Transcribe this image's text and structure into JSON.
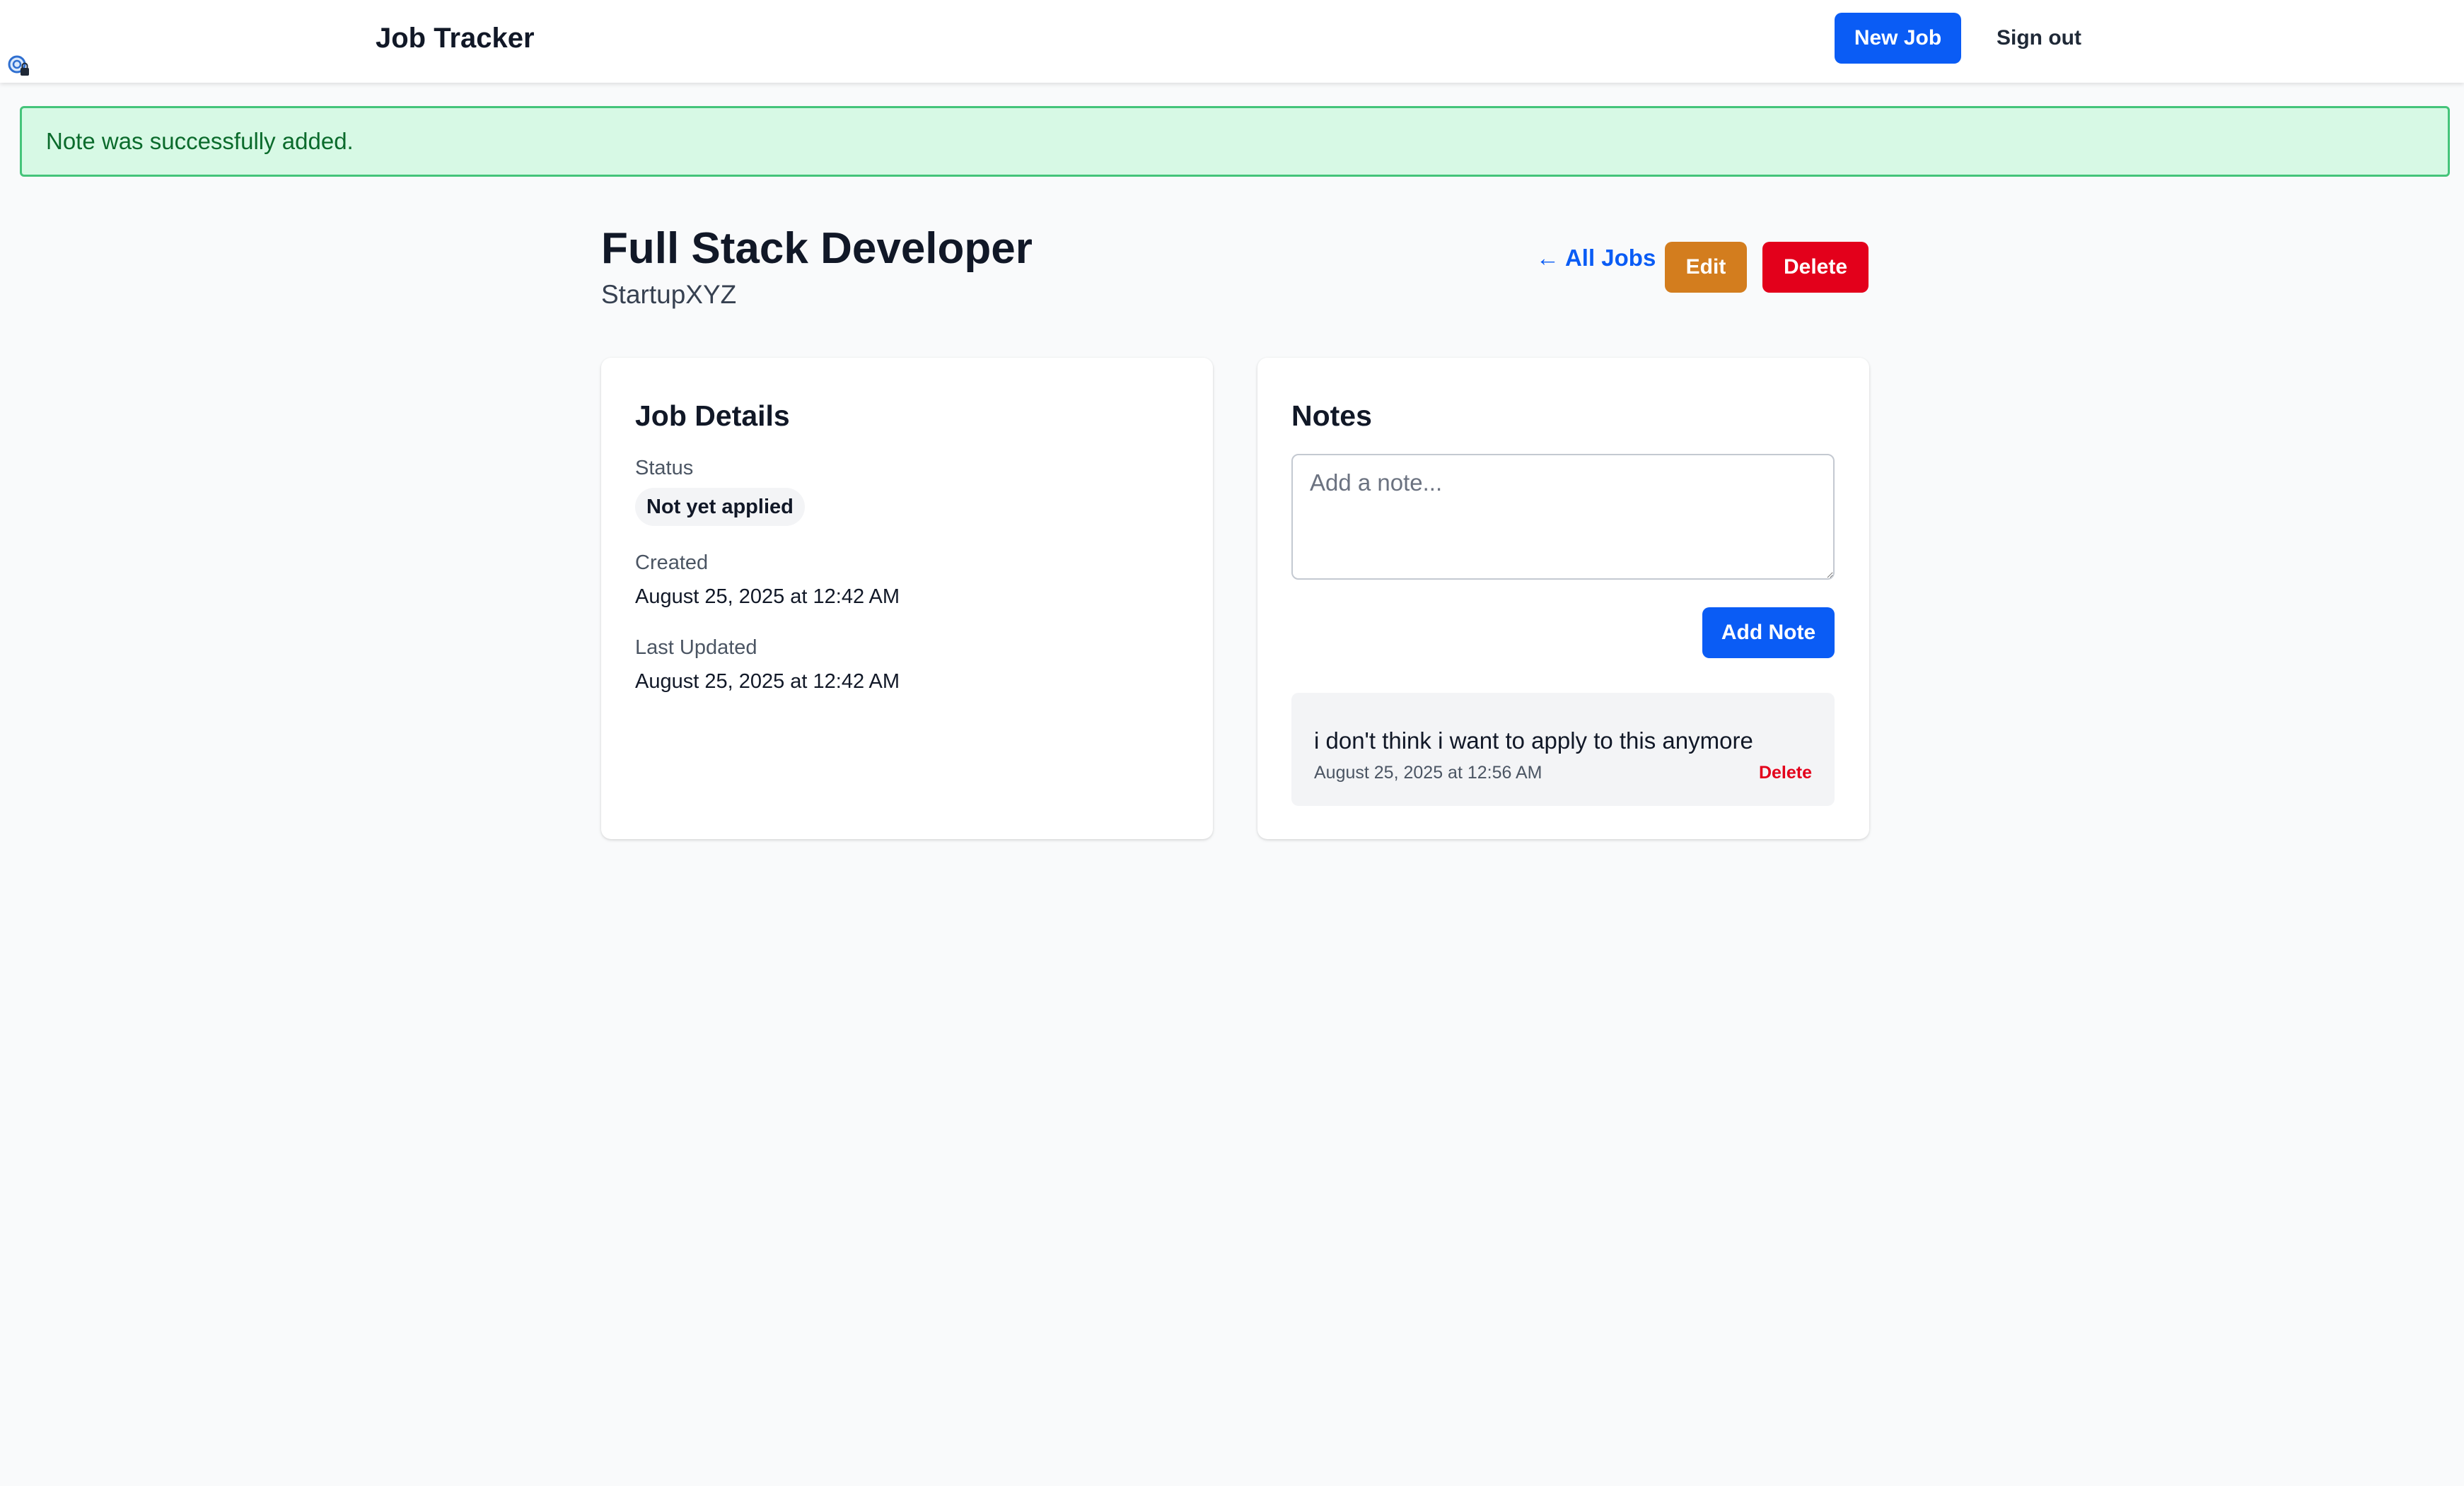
{
  "nav": {
    "brand": "Job Tracker",
    "new_job_label": "New Job",
    "sign_out_label": "Sign out",
    "extension_icon": "lock-badge-icon"
  },
  "flash": {
    "message": "Note was successfully added."
  },
  "job": {
    "title": "Full Stack Developer",
    "company": "StartupXYZ"
  },
  "actions": {
    "all_jobs_label": "← All Jobs",
    "edit_label": "Edit",
    "delete_label": "Delete"
  },
  "details": {
    "heading": "Job Details",
    "status_label": "Status",
    "status_value": "Not yet applied",
    "created_label": "Created",
    "created_value": "August 25, 2025 at 12:42 AM",
    "updated_label": "Last Updated",
    "updated_value": "August 25, 2025 at 12:42 AM"
  },
  "notes": {
    "heading": "Notes",
    "input_placeholder": "Add a note...",
    "input_value": "",
    "add_label": "Add Note",
    "items": [
      {
        "text": "i don't think i want to apply to this anymore",
        "date": "August 25, 2025 at 12:56 AM",
        "delete_label": "Delete"
      }
    ]
  },
  "colors": {
    "primary": "#0a5cf5",
    "warning": "#d37d1e",
    "danger": "#e3001b",
    "success_bg": "#d7f9e5",
    "success_border": "#45c47a",
    "success_text": "#0b6b2c",
    "page_bg": "#f9fafb"
  }
}
